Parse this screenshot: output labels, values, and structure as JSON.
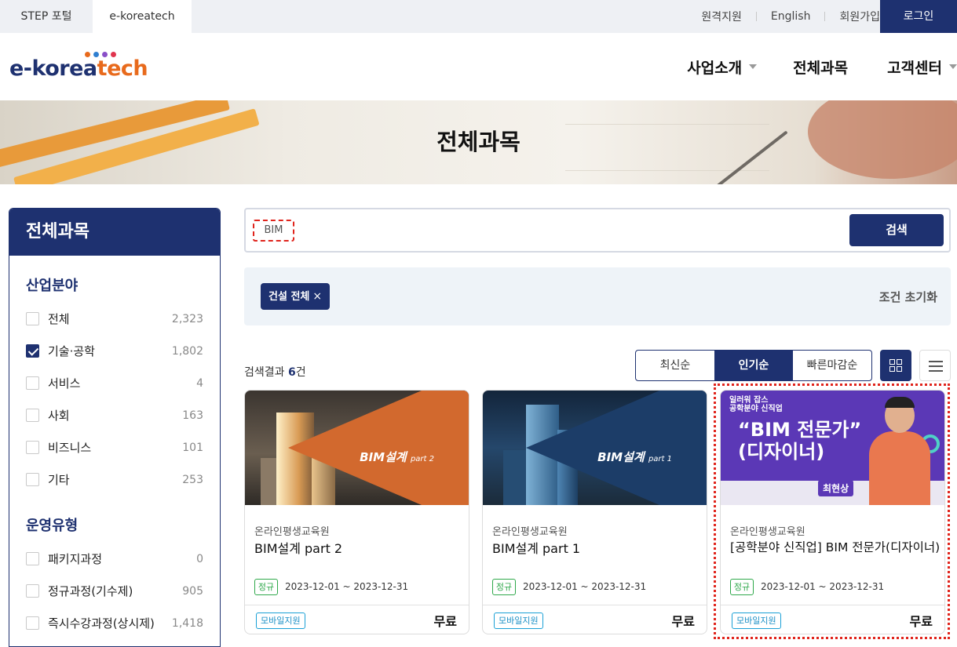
{
  "topbar": {
    "tabs": [
      "STEP 포털",
      "e-koreatech"
    ],
    "links": [
      "원격지원",
      "English",
      "회원가입"
    ],
    "login": "로그인"
  },
  "header": {
    "logo": {
      "part1": "e-korea",
      "part2": "tech"
    },
    "nav": [
      "사업소개",
      "전체과목",
      "고객센터"
    ]
  },
  "banner": {
    "title": "전체과목"
  },
  "sidebar": {
    "title": "전체과목",
    "groups": [
      {
        "title": "산업분야",
        "items": [
          {
            "label": "전체",
            "count": "2,323",
            "checked": false
          },
          {
            "label": "기술·공학",
            "count": "1,802",
            "checked": true
          },
          {
            "label": "서비스",
            "count": "4",
            "checked": false
          },
          {
            "label": "사회",
            "count": "163",
            "checked": false
          },
          {
            "label": "비즈니스",
            "count": "101",
            "checked": false
          },
          {
            "label": "기타",
            "count": "253",
            "checked": false
          }
        ]
      },
      {
        "title": "운영유형",
        "items": [
          {
            "label": "패키지과정",
            "count": "0",
            "checked": false
          },
          {
            "label": "정규과정(기수제)",
            "count": "905",
            "checked": false
          },
          {
            "label": "즉시수강과정(상시제)",
            "count": "1,418",
            "checked": false
          }
        ]
      }
    ]
  },
  "search": {
    "value": "BIM",
    "button": "검색"
  },
  "filters": {
    "chip": "건설 전체",
    "chip_close": "×",
    "reset": "조건 초기화"
  },
  "results": {
    "prefix": "검색결과 ",
    "count": "6",
    "suffix": "건"
  },
  "sort": {
    "options": [
      "최신순",
      "인기순",
      "빠른마감순"
    ],
    "active": "인기순"
  },
  "view": {
    "grid": "grid-icon",
    "list": "list-icon"
  },
  "cards": [
    {
      "thumb_label": "BIM설계",
      "thumb_sub": "part 2",
      "org": "온라인평생교육원",
      "title": "BIM설계 part 2",
      "badge": "정규",
      "period": "2023-12-01 ~ 2023-12-31",
      "mobile": "모바일지원",
      "price": "무료"
    },
    {
      "thumb_label": "BIM설계",
      "thumb_sub": "part 1",
      "org": "온라인평생교육원",
      "title": "BIM설계 part 1",
      "badge": "정규",
      "period": "2023-12-01 ~ 2023-12-31",
      "mobile": "모바일지원",
      "price": "무료"
    },
    {
      "thumb_top": "일러워 잡스\n공학분야 신직업",
      "thumb_big1": "“BIM 전문가”",
      "thumb_big2": "(디자이너)",
      "thumb_name": "최현상",
      "org": "온라인평생교육원",
      "title": "[공학분야 신직업] BIM 전문가(디자이너)",
      "badge": "정규",
      "period": "2023-12-01 ~ 2023-12-31",
      "mobile": "모바일지원",
      "price": "무료"
    }
  ],
  "colors": {
    "primary": "#1e3170",
    "accent": "#e86a1c",
    "highlight": "#e0241c"
  }
}
